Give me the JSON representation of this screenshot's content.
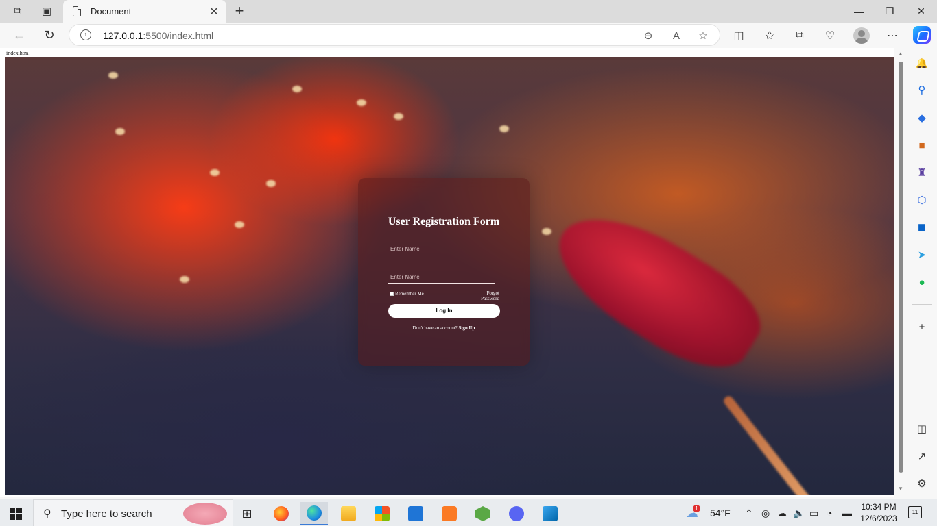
{
  "browser": {
    "tab": {
      "title": "Document",
      "close": "✕"
    },
    "new_tab": "+",
    "window_controls": {
      "minimize": "—",
      "restore": "❐",
      "close": "✕"
    },
    "address": {
      "host": "127.0.0.1",
      "path": ":5500/index.html"
    },
    "info_glyph": "i"
  },
  "page": {
    "label": "index.html",
    "form": {
      "title": "User Registration Form",
      "name_placeholder": "Enter Name",
      "password_placeholder": "Enter Name",
      "remember_label": "Remember Me",
      "forgot_label": "Forgot Password",
      "login_label": "Log In",
      "signup_prompt": "Don't have an account?",
      "signup_link": "Sign Up"
    }
  },
  "taskbar": {
    "search_text": "Type here to search",
    "weather": {
      "temp": "54°F",
      "badge": "1"
    },
    "time": "10:34 PM",
    "date": "12/6/2023",
    "notification_count": "11"
  }
}
